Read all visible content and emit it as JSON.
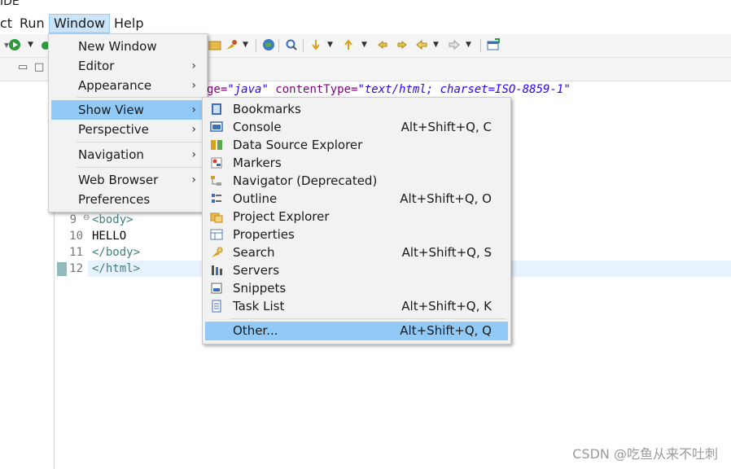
{
  "title_fragment": "IDE",
  "menubar": {
    "items": [
      "ct",
      "Run",
      "Window",
      "Help"
    ]
  },
  "window_menu": {
    "items": [
      {
        "label": "New Window",
        "submenu": false
      },
      {
        "label": "Editor",
        "submenu": true
      },
      {
        "label": "Appearance",
        "submenu": true
      },
      {
        "label": "Show View",
        "submenu": true,
        "highlighted": true
      },
      {
        "label": "Perspective",
        "submenu": true
      },
      {
        "label": "Navigation",
        "submenu": true
      },
      {
        "label": "Web Browser",
        "submenu": true
      },
      {
        "label": "Preferences",
        "submenu": false
      }
    ]
  },
  "show_view_menu": {
    "items": [
      {
        "label": "Bookmarks",
        "shortcut": "",
        "icon": "bookmarks-icon"
      },
      {
        "label": "Console",
        "shortcut": "Alt+Shift+Q, C",
        "icon": "console-icon"
      },
      {
        "label": "Data Source Explorer",
        "shortcut": "",
        "icon": "data-source-explorer-icon"
      },
      {
        "label": "Markers",
        "shortcut": "",
        "icon": "markers-icon"
      },
      {
        "label": "Navigator (Deprecated)",
        "shortcut": "",
        "icon": "navigator-icon"
      },
      {
        "label": "Outline",
        "shortcut": "Alt+Shift+Q, O",
        "icon": "outline-icon"
      },
      {
        "label": "Project Explorer",
        "shortcut": "",
        "icon": "project-explorer-icon"
      },
      {
        "label": "Properties",
        "shortcut": "",
        "icon": "properties-icon"
      },
      {
        "label": "Search",
        "shortcut": "Alt+Shift+Q, S",
        "icon": "search-icon"
      },
      {
        "label": "Servers",
        "shortcut": "",
        "icon": "servers-icon"
      },
      {
        "label": "Snippets",
        "shortcut": "",
        "icon": "snippets-icon"
      },
      {
        "label": "Task List",
        "shortcut": "Alt+Shift+Q, K",
        "icon": "task-list-icon"
      }
    ],
    "other": {
      "label": "Other...",
      "shortcut": "Alt+Shift+Q, Q"
    }
  },
  "editor": {
    "first_line_fragment": {
      "pre": "ge=",
      "val1": "\"java\"",
      "attr2": " contentType=",
      "val2": "\"text/html; charset=ISO-8859-1\""
    },
    "lines": [
      {
        "num": "9",
        "text": "<body>",
        "kind": "tag"
      },
      {
        "num": "10",
        "text": "HELLO",
        "kind": "text"
      },
      {
        "num": "11",
        "text": "</body>",
        "kind": "tag"
      },
      {
        "num": "12",
        "text": "</html>",
        "kind": "tag"
      }
    ],
    "fold_marker": "⊖"
  },
  "watermark": "CSDN @吃鱼从来不吐刺"
}
